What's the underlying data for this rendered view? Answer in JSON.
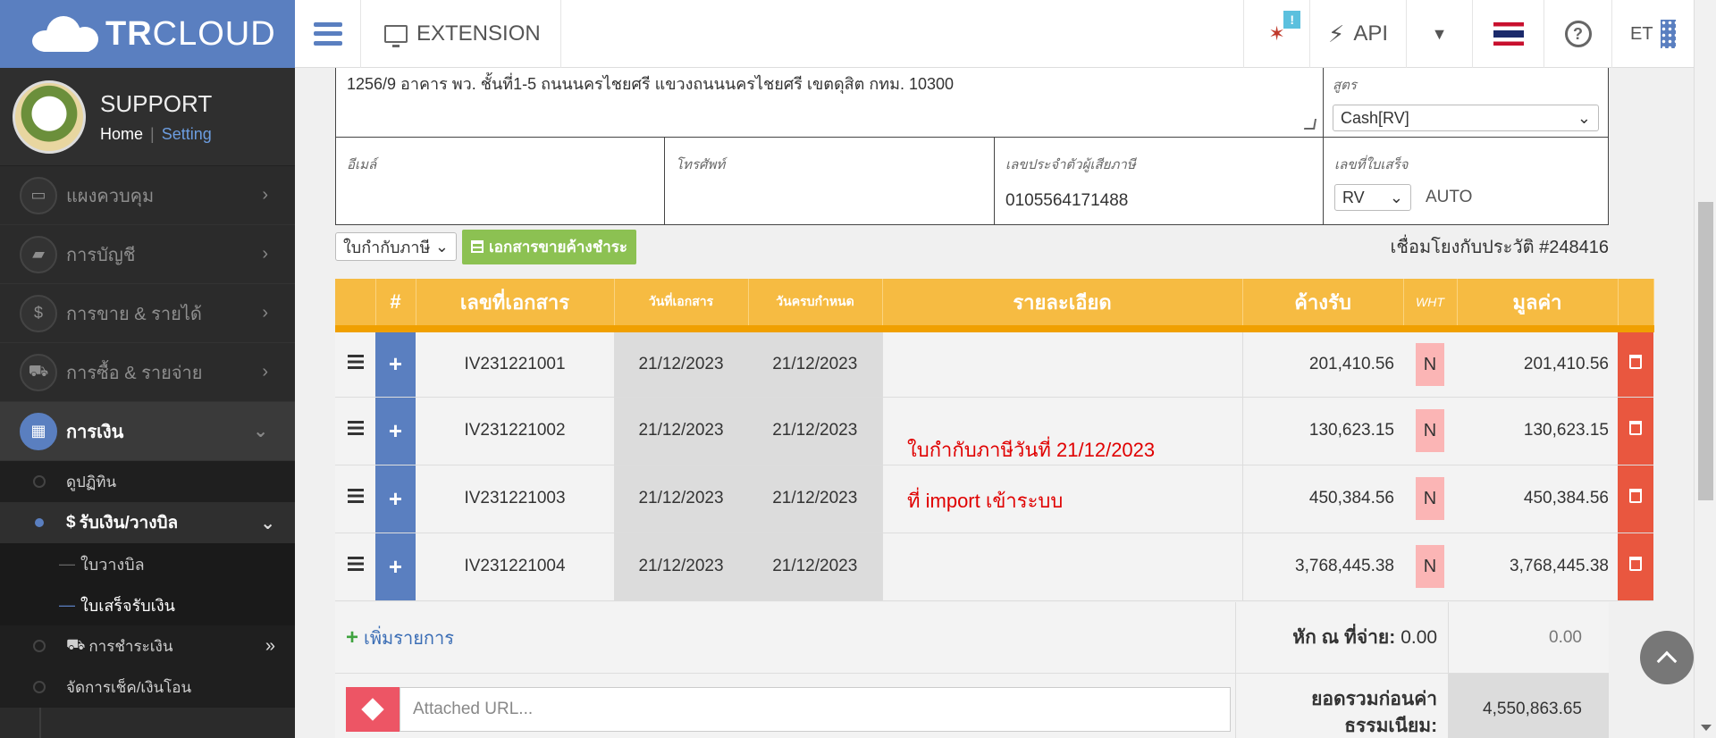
{
  "brand": {
    "bold": "TR",
    "light": "CLOUD"
  },
  "profile": {
    "name": "SUPPORT",
    "home": "Home",
    "setting": "Setting"
  },
  "sidebar": {
    "items": [
      {
        "label": "แผงควบคุม"
      },
      {
        "label": "การบัญชี"
      },
      {
        "label": "การขาย & รายได้"
      },
      {
        "label": "การซื้อ & รายจ่าย"
      },
      {
        "label": "การเงิน"
      }
    ],
    "finance_sub": [
      {
        "label": "ดูปฏิทิน"
      },
      {
        "label": "รับเงิน/วางบิล"
      }
    ],
    "receive_sub": [
      {
        "label": "ใบวางบิล"
      },
      {
        "label": "ใบเสร็จรับเงิน"
      }
    ],
    "more_sub": [
      {
        "label": "การชำระเงิน"
      },
      {
        "label": "จัดการเช็ค/เงินโอน"
      }
    ]
  },
  "topbar": {
    "extension": "EXTENSION",
    "badge": "!",
    "api": "API",
    "user": "ET"
  },
  "form": {
    "address": "1256/9 อาคาร พว. ชั้นที่1-5 ถนนนครไชยศรี แขวงถนนนครไชยศรี เขตดุสิต กทม. 10300",
    "formula_label": "สูตร",
    "formula_value": "Cash[RV]",
    "email_label": "อีเมล์",
    "email_value": "",
    "phone_label": "โทรศัพท์",
    "phone_value": "",
    "taxid_label": "เลขประจำตัวผู้เสียภาษี",
    "taxid_value": "0105564171488",
    "receipt_no_label": "เลขที่ใบเสร็จ",
    "receipt_prefix": "RV",
    "receipt_auto": "AUTO"
  },
  "toolbar": {
    "doc_type": "ใบกำกับภาษี",
    "outstanding_btn": "เอกสารขายค้างชำระ",
    "history_link": "เชื่อมโยงกับประวัติ #248416"
  },
  "table": {
    "headers": {
      "hash": "#",
      "doc_no": "เลขที่เอกสาร",
      "doc_date": "วันที่เอกสาร",
      "due_date": "วันครบกำหนด",
      "detail": "รายละเอียด",
      "receivable": "ค้างรับ",
      "wht": "WHT",
      "amount": "มูลค่า"
    },
    "rows": [
      {
        "doc_no": "IV231221001",
        "doc_date": "21/12/2023",
        "due_date": "21/12/2023",
        "receivable": "201,410.56",
        "wht": "N",
        "amount": "201,410.56"
      },
      {
        "doc_no": "IV231221002",
        "doc_date": "21/12/2023",
        "due_date": "21/12/2023",
        "receivable": "130,623.15",
        "wht": "N",
        "amount": "130,623.15"
      },
      {
        "doc_no": "IV231221003",
        "doc_date": "21/12/2023",
        "due_date": "21/12/2023",
        "receivable": "450,384.56",
        "wht": "N",
        "amount": "450,384.56"
      },
      {
        "doc_no": "IV231221004",
        "doc_date": "21/12/2023",
        "due_date": "21/12/2023",
        "receivable": "3,768,445.38",
        "wht": "N",
        "amount": "3,768,445.38"
      }
    ],
    "plus_symbol": "+"
  },
  "annotation": {
    "line1": "ใบกำกับภาษีวันที่ 21/12/2023",
    "line2": "ที่ import เข้าระบบ"
  },
  "footer": {
    "add_item": "เพิ่มรายการ",
    "wht_label": "หัก ณ ที่จ่าย:",
    "wht_inline": "0.00",
    "wht_total": "0.00",
    "url_placeholder": "Attached URL...",
    "subtotal_label": "ยอดรวมก่อนค่าธรรมเนียม:",
    "subtotal_value": "4,550,863.65"
  }
}
